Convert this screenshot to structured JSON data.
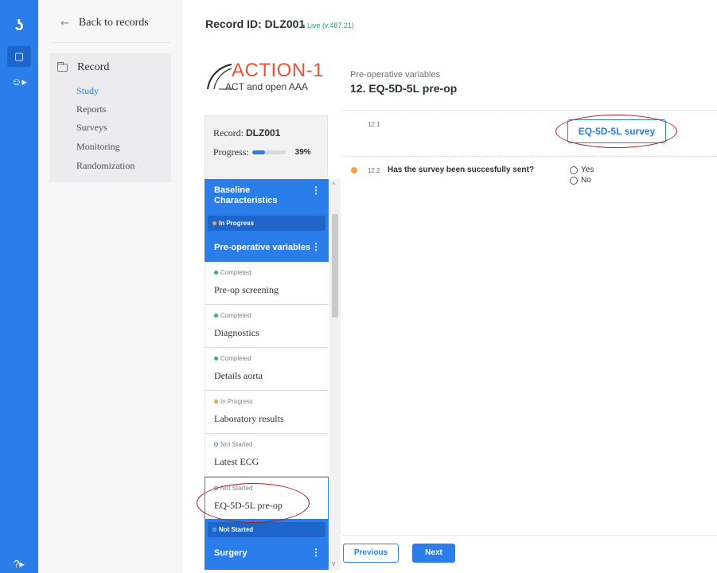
{
  "rail": {
    "logo_icon": "app-logo-icon",
    "items": [
      {
        "icon": "records-icon"
      },
      {
        "icon": "user-icon"
      },
      {
        "icon": "help-icon"
      }
    ]
  },
  "subnav": {
    "back_label": "Back to records",
    "section_label": "Record",
    "items": [
      {
        "label": "Study",
        "active": true
      },
      {
        "label": "Reports"
      },
      {
        "label": "Surveys"
      },
      {
        "label": "Monitoring"
      },
      {
        "label": "Randomization"
      }
    ]
  },
  "header": {
    "record_id": "Record ID: DLZ001",
    "live": "Live (v.487.21)"
  },
  "logo": {
    "title": "ACTION-1",
    "subtitle": "ACT and open AAA"
  },
  "record_card": {
    "record_label": "Record: ",
    "record_value": "DLZ001",
    "progress_label": "Progress:",
    "progress_percent": "39%",
    "progress_fraction": 0.39
  },
  "steps": {
    "group1": {
      "title_line1": "Baseline",
      "title_line2": "Characteristics",
      "kebab": "⋮"
    },
    "group2_status": "In Progress",
    "group2": {
      "title": "Pre-operative variables",
      "kebab": "⋮"
    },
    "items": [
      {
        "status": "Completed",
        "name": "Pre-op screening",
        "status_color": "#2fb36f"
      },
      {
        "status": "Completed",
        "name": "Diagnostics",
        "status_color": "#2fb36f"
      },
      {
        "status": "Completed",
        "name": "Details aorta",
        "status_color": "#2fb36f"
      },
      {
        "status": "In Progress",
        "name": "Laboratory results",
        "status_color": "#f0a23c"
      },
      {
        "status": "Not Started",
        "name": "Latest ECG",
        "status_color": "#2b7de9"
      },
      {
        "status": "Not Started",
        "name": "EQ-5D-5L pre-op",
        "status_color": "#2b7de9"
      }
    ],
    "group3_status": "Not Started",
    "group3": {
      "title": "Surgery",
      "kebab": "⋮"
    }
  },
  "form": {
    "section_heading": "Pre-operative variables",
    "section_title": "12. EQ-5D-5L pre-op",
    "q1_number": "12.1",
    "survey_button": "EQ-5D-5L survey",
    "q2_number": "12.2",
    "q2_text": "Has the survey been succesfully sent?",
    "options": [
      "Yes",
      "No"
    ]
  },
  "footer": {
    "previous": "Previous",
    "next": "Next"
  },
  "colors": {
    "accent": "#2b7de9",
    "annotation": "#b01e22",
    "brand": "#e8533a"
  }
}
